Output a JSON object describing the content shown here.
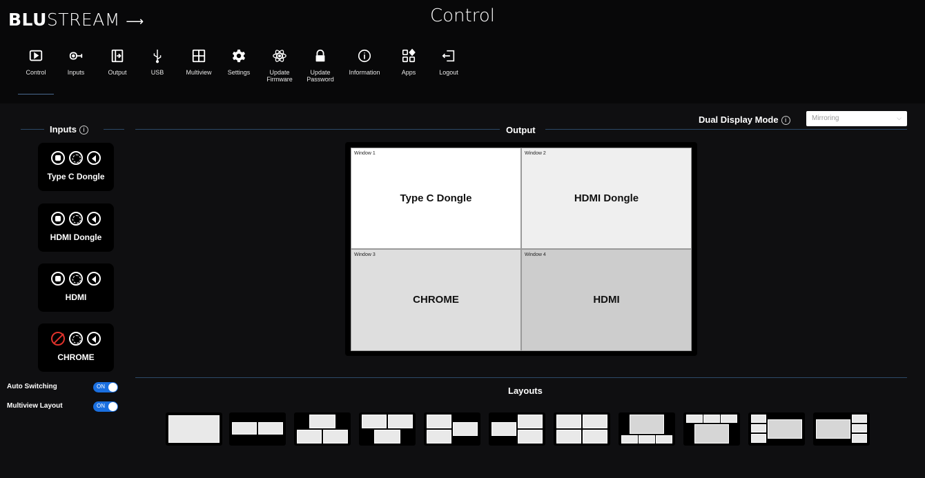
{
  "header": {
    "logo_bold": "BLU",
    "logo_rest": "STREAM",
    "title": "Control"
  },
  "nav": [
    {
      "label": "Control",
      "icon": "play-screen-icon",
      "active": true
    },
    {
      "label": "Inputs",
      "icon": "input-connector-icon"
    },
    {
      "label": "Output",
      "icon": "output-icon"
    },
    {
      "label": "USB",
      "icon": "usb-icon"
    },
    {
      "label": "Multiview",
      "icon": "multiview-grid-icon"
    },
    {
      "label": "Settings",
      "icon": "gear-icon"
    },
    {
      "label": "Update Firmware",
      "icon": "atom-icon"
    },
    {
      "label": "Update Password",
      "icon": "lock-icon"
    },
    {
      "label": "Information",
      "icon": "info-icon"
    },
    {
      "label": "Apps",
      "icon": "apps-icon"
    },
    {
      "label": "Logout",
      "icon": "logout-icon"
    }
  ],
  "inputs_section": {
    "title": "Inputs",
    "items": [
      {
        "name": "Type C Dongle",
        "stop_blocked": false
      },
      {
        "name": "HDMI Dongle",
        "stop_blocked": false
      },
      {
        "name": "HDMI",
        "stop_blocked": false
      },
      {
        "name": "CHROME",
        "stop_blocked": true
      }
    ]
  },
  "output_section": {
    "title": "Output",
    "windows": [
      {
        "label": "Window 1",
        "source": "Type C Dongle",
        "bg": "#ffffff"
      },
      {
        "label": "Window 2",
        "source": "HDMI Dongle",
        "bg": "#efefef"
      },
      {
        "label": "Window 3",
        "source": "CHROME",
        "bg": "#dedede"
      },
      {
        "label": "Window 4",
        "source": "HDMI",
        "bg": "#cdcdcd"
      }
    ]
  },
  "dual_display": {
    "label": "Dual Display Mode",
    "value": "Mirroring"
  },
  "toggles": {
    "auto_switching": {
      "label": "Auto Switching",
      "state": "ON"
    },
    "multiview_layout": {
      "label": "Multiview Layout",
      "state": "ON"
    }
  },
  "layouts_section": {
    "title": "Layouts"
  },
  "colors": {
    "background": "#0f0f11",
    "accent_line": "#2d4a6a",
    "toggle_on": "#1a6fe0",
    "blocked": "#e0322b"
  }
}
